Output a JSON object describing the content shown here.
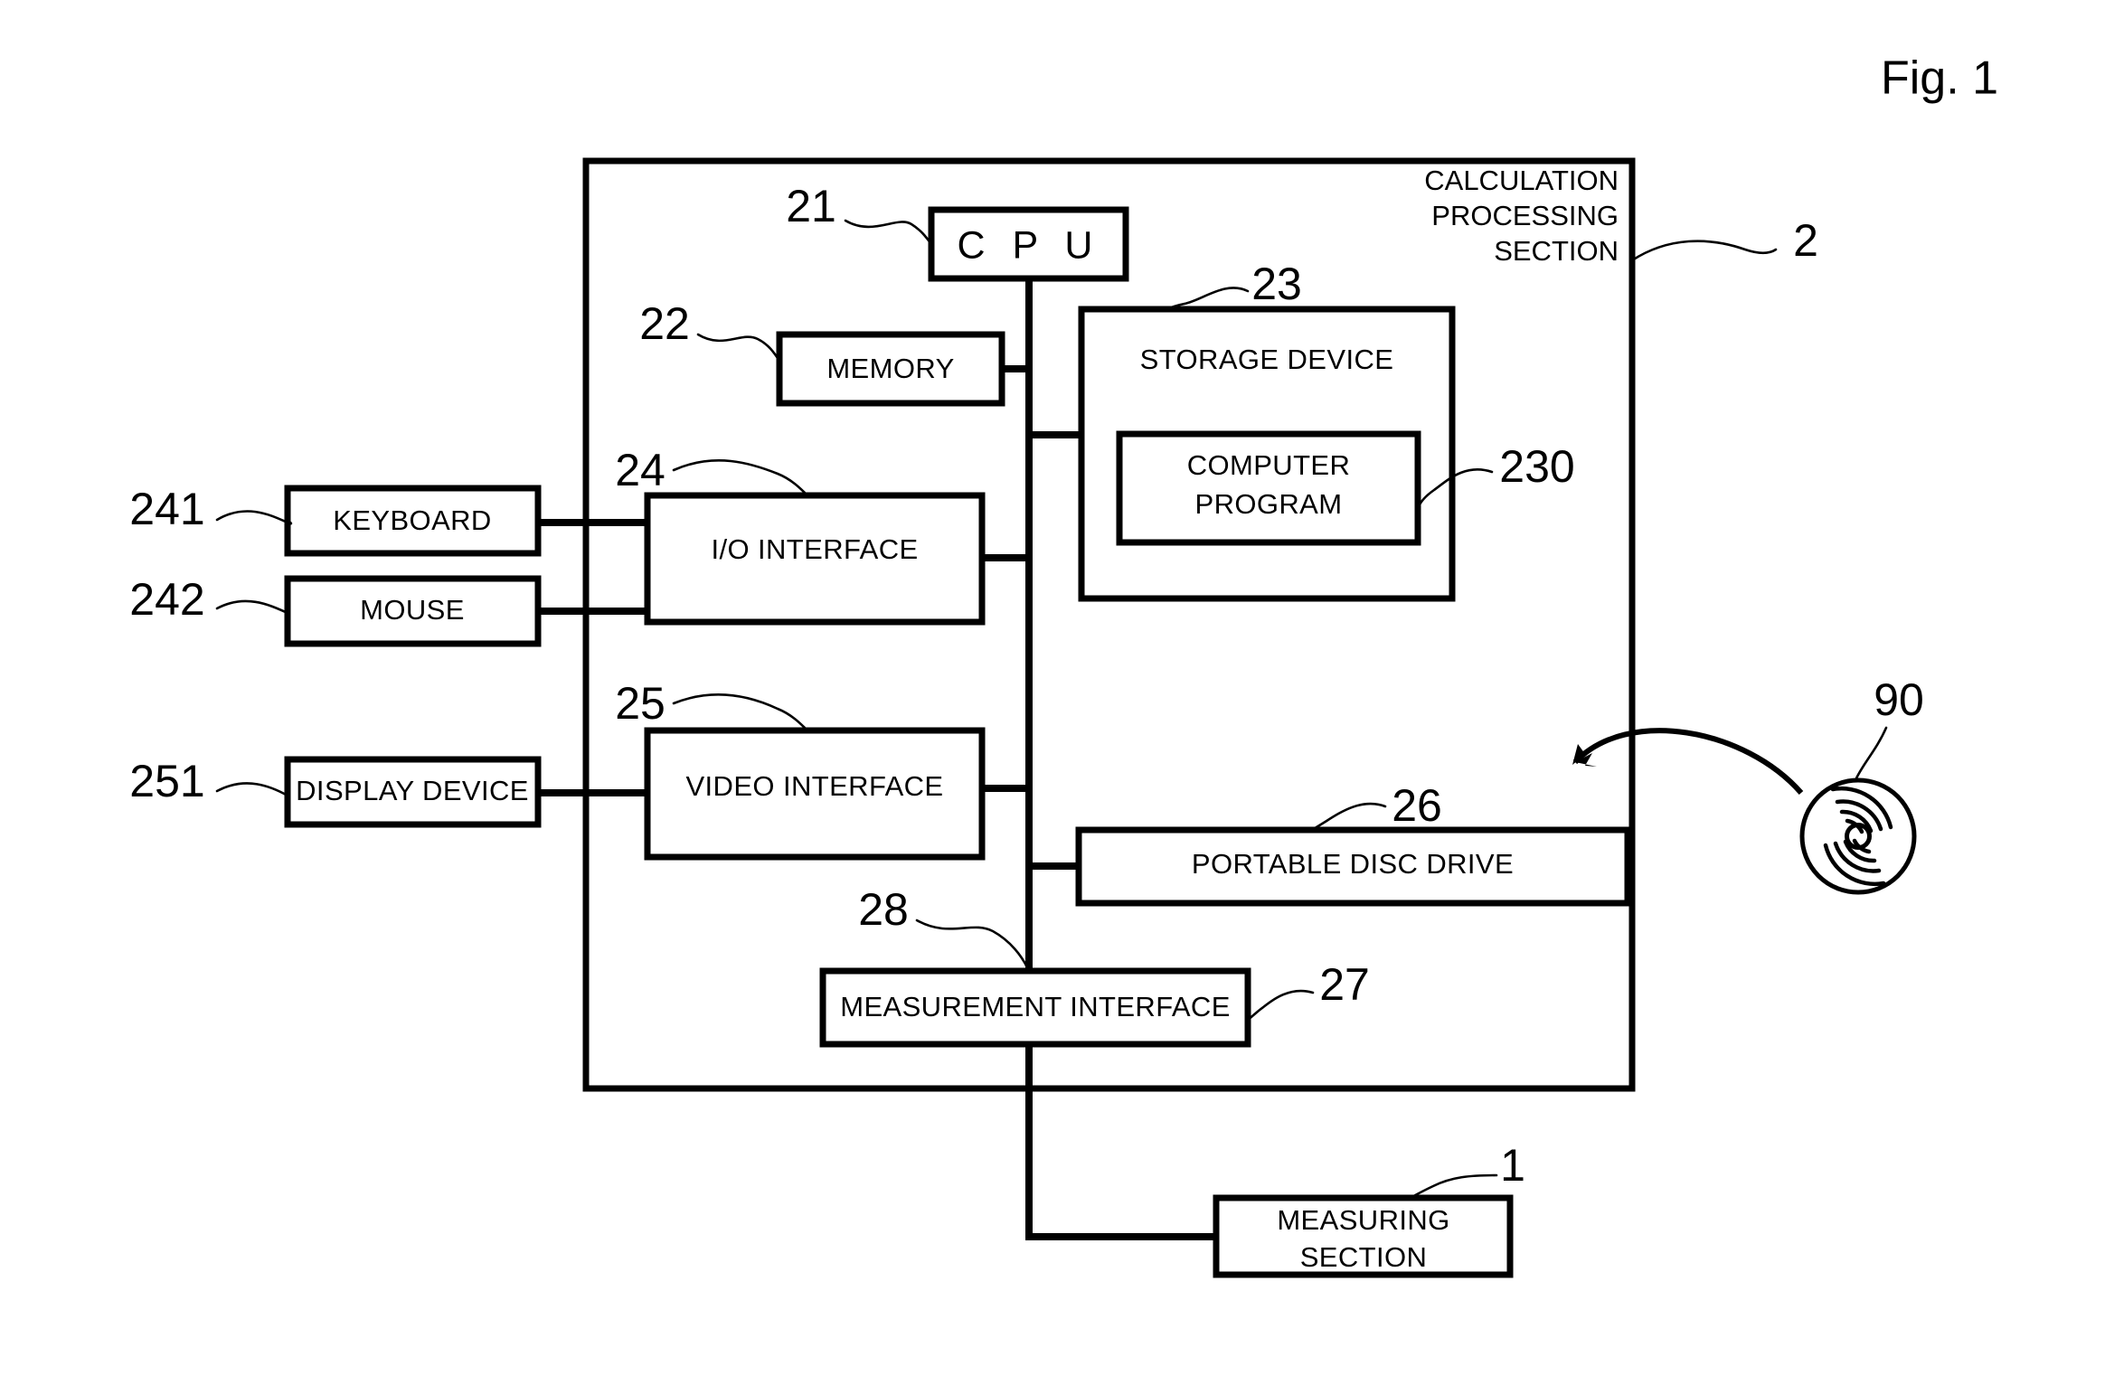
{
  "figure": {
    "title": "Fig. 1"
  },
  "outer_section": {
    "caption_line1": "CALCULATION",
    "caption_line2": "PROCESSING",
    "caption_line3": "SECTION",
    "ref": "2"
  },
  "blocks": {
    "cpu": {
      "label": "C P U",
      "ref": "21"
    },
    "memory": {
      "label": "MEMORY",
      "ref": "22"
    },
    "storage_device": {
      "label": "STORAGE DEVICE",
      "ref": "23"
    },
    "computer_program": {
      "label_line1": "COMPUTER",
      "label_line2": "PROGRAM",
      "ref": "230"
    },
    "io_interface": {
      "label": "I/O INTERFACE",
      "ref": "24"
    },
    "video_interface": {
      "label": "VIDEO INTERFACE",
      "ref": "25"
    },
    "portable_disc_drive": {
      "label": "PORTABLE DISC DRIVE",
      "ref": "26"
    },
    "measurement_interface": {
      "label": "MEASUREMENT INTERFACE",
      "ref": "27"
    },
    "bus": {
      "ref": "28"
    },
    "keyboard": {
      "label": "KEYBOARD",
      "ref": "241"
    },
    "mouse": {
      "label": "MOUSE",
      "ref": "242"
    },
    "display_device": {
      "label": "DISPLAY DEVICE",
      "ref": "251"
    },
    "measuring_section": {
      "label_line1": "MEASURING",
      "label_line2": "SECTION",
      "ref": "1"
    },
    "portable_disc": {
      "ref": "90"
    }
  },
  "colors": {
    "stroke": "#000000",
    "background": "#ffffff"
  }
}
